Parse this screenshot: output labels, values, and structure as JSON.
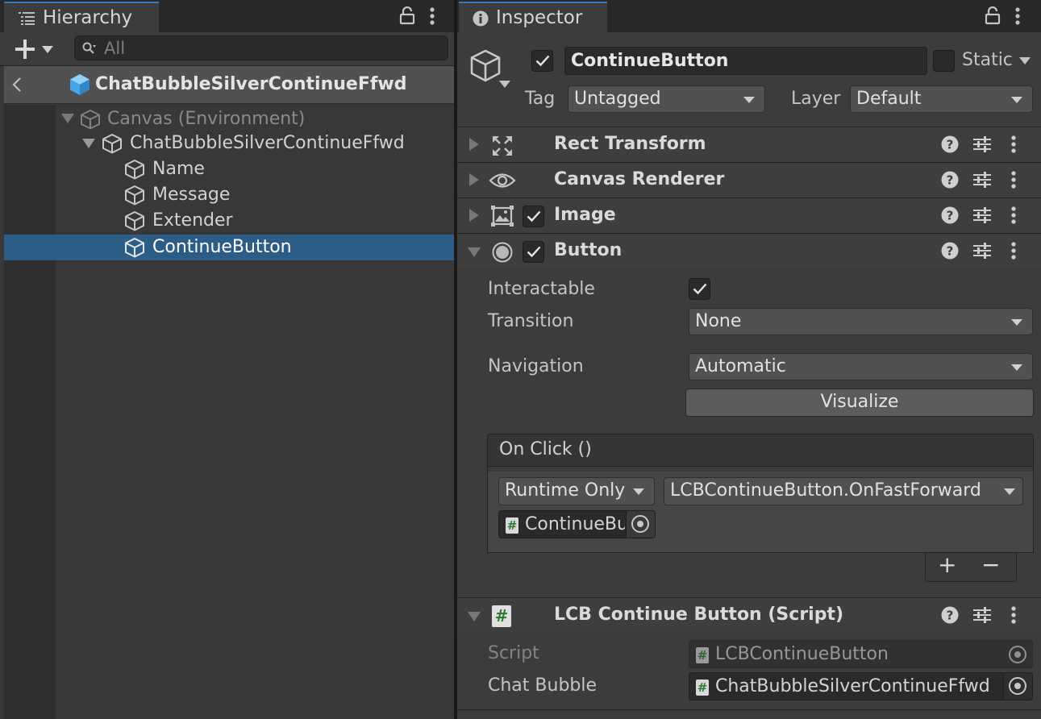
{
  "hierarchy": {
    "tab_label": "Hierarchy",
    "search_placeholder": "All",
    "prefab_title": "ChatBubbleSilverContinueFfwd",
    "tree": [
      {
        "label": "Canvas (Environment)"
      },
      {
        "label": "ChatBubbleSilverContinueFfwd"
      },
      {
        "label": "Name"
      },
      {
        "label": "Message"
      },
      {
        "label": "Extender"
      },
      {
        "label": "ContinueButton"
      }
    ]
  },
  "inspector": {
    "tab_label": "Inspector",
    "object_name": "ContinueButton",
    "static_label": "Static",
    "tag_label": "Tag",
    "tag_value": "Untagged",
    "layer_label": "Layer",
    "layer_value": "Default",
    "components": [
      {
        "title": "Rect Transform"
      },
      {
        "title": "Canvas Renderer"
      },
      {
        "title": "Image"
      },
      {
        "title": "Button"
      },
      {
        "title": "LCB Continue Button (Script)"
      }
    ],
    "button": {
      "interactable_label": "Interactable",
      "transition_label": "Transition",
      "transition_value": "None",
      "navigation_label": "Navigation",
      "navigation_value": "Automatic",
      "visualize_label": "Visualize",
      "onclick_label": "On Click ()",
      "runtime_value": "Runtime Only",
      "function_value": "LCBContinueButton.OnFastForward",
      "target_object": "ContinueButton",
      "add_label": "+",
      "remove_label": "−"
    },
    "script": {
      "script_label": "Script",
      "script_value": "LCBContinueButton",
      "chat_bubble_label": "Chat Bubble",
      "chat_bubble_value": "ChatBubbleSilverContinueFfwd"
    }
  },
  "colors": {
    "selection": "#2c5d87",
    "prefab_icon": "#5ab0f0",
    "accent_tab": "#3a79bb"
  }
}
